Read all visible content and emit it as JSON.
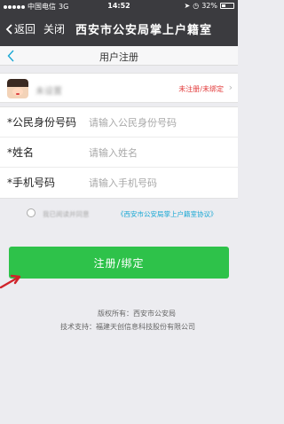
{
  "status_bar": {
    "carrier": "中国电信",
    "network": "3G",
    "time": "14:52",
    "battery_text": "32%",
    "battery_level": 0.32
  },
  "nav": {
    "back_label": "返回",
    "close_label": "关闭",
    "title": "西安市公安局掌上户籍室"
  },
  "page": {
    "title": "用户注册"
  },
  "user": {
    "name": "未设置",
    "status": "未注册/未绑定"
  },
  "form": {
    "fields": [
      {
        "label": "*公民身份号码",
        "placeholder": "请输入公民身份号码",
        "value": ""
      },
      {
        "label": "*姓名",
        "placeholder": "请输入姓名",
        "value": ""
      },
      {
        "label": "*手机号码",
        "placeholder": "请输入手机号码",
        "value": ""
      }
    ]
  },
  "agreement": {
    "prefix": "我已阅读并同意",
    "link_text": "《西安市公安局掌上户籍室协议》",
    "checked": false
  },
  "submit_label": "注册/绑定",
  "footer": {
    "copyright": "版权所有：西安市公安局",
    "support": "技术支持：福建天创信息科技股份有限公司"
  },
  "colors": {
    "header_bg": "#3b3b3f",
    "accent_green": "#2ec24a",
    "link_blue": "#1aa8d4",
    "status_red": "#e23a3a",
    "annotation_arrow": "#d0232a"
  }
}
